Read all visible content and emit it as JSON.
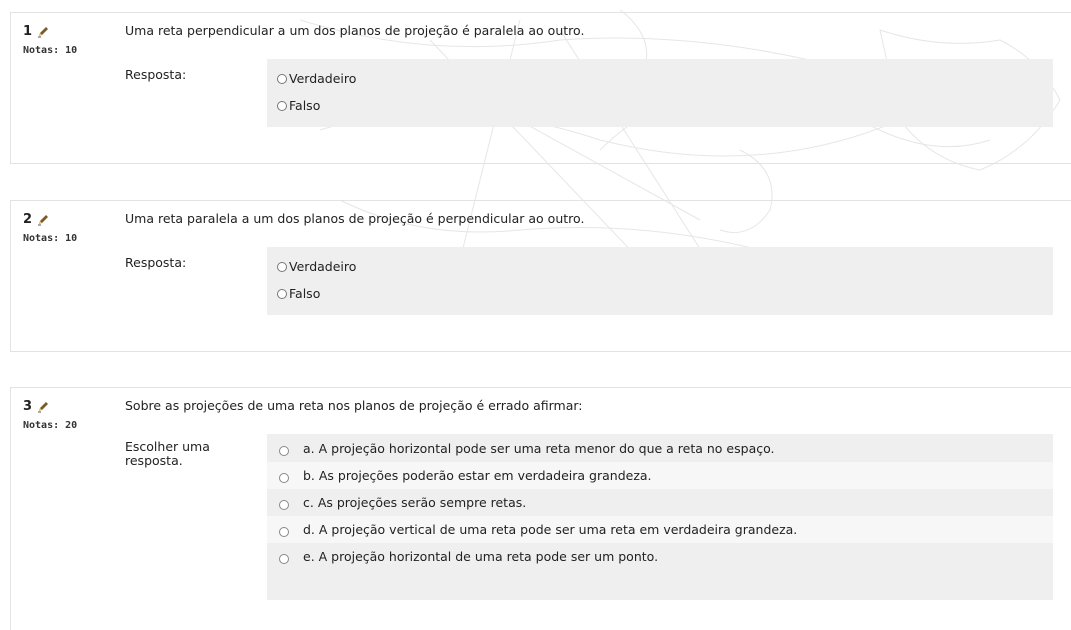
{
  "questions": [
    {
      "number": "1",
      "grade": "Notas: 10",
      "text": "Uma reta perpendicular a um dos planos de projeção é paralela ao outro.",
      "answer_label": "Resposta:",
      "options": [
        "Verdadeiro",
        "Falso"
      ]
    },
    {
      "number": "2",
      "grade": "Notas: 10",
      "text": "Uma reta paralela a um dos planos de projeção é perpendicular ao outro.",
      "answer_label": "Resposta:",
      "options": [
        "Verdadeiro",
        "Falso"
      ]
    },
    {
      "number": "3",
      "grade": "Notas: 20",
      "text": "Sobre as projeções de uma reta nos planos de projeção é errado afirmar:",
      "answer_label": "Escolher uma resposta.",
      "options": [
        "a. A projeção horizontal pode ser uma reta menor do que a reta no espaço.",
        "b. As projeções poderão estar em verdadeira grandeza.",
        "c. As projeções serão sempre retas.",
        "d. A projeção vertical de uma reta pode ser uma reta em verdadeira grandeza.",
        "e. A projeção horizontal de uma reta pode ser um ponto."
      ]
    }
  ],
  "colors": {
    "answer_bg": "#efefef",
    "border": "#e3e3e3",
    "text": "#222222"
  },
  "icons": {
    "edit": "pencil-icon",
    "radio": "radio-unchecked"
  }
}
